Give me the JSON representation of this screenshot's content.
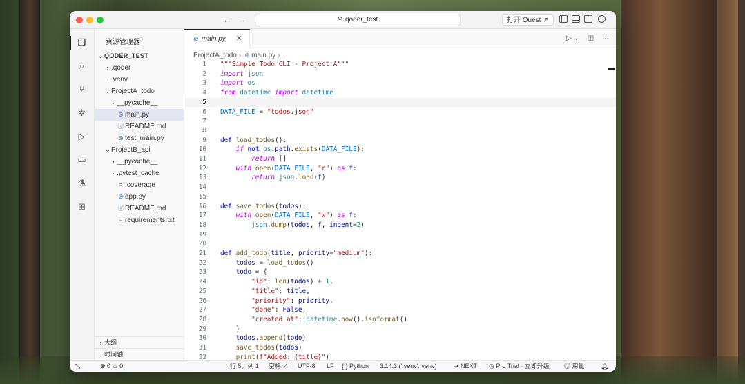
{
  "titlebar": {
    "search_text": "qoder_test",
    "quest_label": "打开 Quest ↗"
  },
  "sidebar": {
    "title": "资源管理器",
    "root": "QODER_TEST",
    "items": [
      {
        "label": ".qoder",
        "kind": "folder",
        "chev": "›"
      },
      {
        "label": ".venv",
        "kind": "folder",
        "chev": "›"
      },
      {
        "label": "ProjectA_todo",
        "kind": "folder-open",
        "chev": "⌄"
      },
      {
        "label": "__pycache__",
        "kind": "folder",
        "chev": "›"
      },
      {
        "label": "main.py",
        "kind": "py",
        "chev": ""
      },
      {
        "label": "README.md",
        "kind": "md",
        "chev": ""
      },
      {
        "label": "test_main.py",
        "kind": "py",
        "chev": ""
      },
      {
        "label": "ProjectB_api",
        "kind": "folder-open",
        "chev": "⌄"
      },
      {
        "label": "__pycache__",
        "kind": "folder",
        "chev": "›"
      },
      {
        "label": ".pytest_cache",
        "kind": "folder",
        "chev": "›"
      },
      {
        "label": ".coverage",
        "kind": "txt",
        "chev": ""
      },
      {
        "label": "app.py",
        "kind": "py",
        "chev": ""
      },
      {
        "label": "README.md",
        "kind": "md",
        "chev": ""
      },
      {
        "label": "requirements.txt",
        "kind": "txt",
        "chev": ""
      }
    ],
    "outline_label": "大纲",
    "timeline_label": "时间轴"
  },
  "editor": {
    "tab_label": "main.py",
    "breadcrumb": [
      "ProjectA_todo",
      "main.py",
      "..."
    ],
    "current_line": 5,
    "lines": [
      {
        "n": "1",
        "html": "<span class='docstr'>\"\"\"Simple Todo CLI - Project A\"\"\"</span>"
      },
      {
        "n": "2",
        "html": "<span class='kw-i'>import</span> <span class='mod'>json</span>"
      },
      {
        "n": "3",
        "html": "<span class='kw-i'>import</span> <span class='mod'>os</span>"
      },
      {
        "n": "4",
        "html": "<span class='kw-i'>from</span> <span class='mod'>datetime</span> <span class='kw-i'>import</span> <span class='mod'>datetime</span>"
      },
      {
        "n": "5",
        "html": ""
      },
      {
        "n": "6",
        "html": "<span class='const'>DATA_FILE</span> = <span class='str'>\"todos.json\"</span>"
      },
      {
        "n": "7",
        "html": ""
      },
      {
        "n": "8",
        "html": ""
      },
      {
        "n": "9",
        "html": "<span class='kw'>def</span> <span class='fn'>load_todos</span>():"
      },
      {
        "n": "10",
        "html": "    <span class='kw-i'>if</span> <span class='kw'>not</span> <span class='mod'>os</span>.<span class='var'>path</span>.<span class='fn'>exists</span>(<span class='const'>DATA_FILE</span>):"
      },
      {
        "n": "11",
        "html": "        <span class='kw-i'>return</span> []"
      },
      {
        "n": "12",
        "html": "    <span class='kw-i'>with</span> <span class='fn'>open</span>(<span class='const'>DATA_FILE</span>, <span class='str'>\"r\"</span>) <span class='kw-i'>as</span> <span class='var'>f</span>:"
      },
      {
        "n": "13",
        "html": "        <span class='kw-i'>return</span> <span class='mod'>json</span>.<span class='fn'>load</span>(<span class='var'>f</span>)"
      },
      {
        "n": "14",
        "html": ""
      },
      {
        "n": "15",
        "html": ""
      },
      {
        "n": "16",
        "html": "<span class='kw'>def</span> <span class='fn'>save_todos</span>(<span class='var'>todos</span>):"
      },
      {
        "n": "17",
        "html": "    <span class='kw-i'>with</span> <span class='fn'>open</span>(<span class='const'>DATA_FILE</span>, <span class='str'>\"w\"</span>) <span class='kw-i'>as</span> <span class='var'>f</span>:"
      },
      {
        "n": "18",
        "html": "        <span class='mod'>json</span>.<span class='fn'>dump</span>(<span class='var'>todos</span>, <span class='var'>f</span>, <span class='var'>indent</span>=<span class='num'>2</span>)"
      },
      {
        "n": "19",
        "html": ""
      },
      {
        "n": "20",
        "html": ""
      },
      {
        "n": "21",
        "html": "<span class='kw'>def</span> <span class='fn'>add_todo</span>(<span class='var'>title</span>, <span class='var'>priority</span>=<span class='str'>\"medium\"</span>):"
      },
      {
        "n": "22",
        "html": "    <span class='var'>todos</span> = <span class='fn'>load_todos</span>()"
      },
      {
        "n": "23",
        "html": "    <span class='var'>todo</span> = {"
      },
      {
        "n": "24",
        "html": "        <span class='str'>\"id\"</span>: <span class='fn'>len</span>(<span class='var'>todos</span>) + <span class='num'>1</span>,"
      },
      {
        "n": "25",
        "html": "        <span class='str'>\"title\"</span>: <span class='var'>title</span>,"
      },
      {
        "n": "26",
        "html": "        <span class='str'>\"priority\"</span>: <span class='var'>priority</span>,"
      },
      {
        "n": "27",
        "html": "        <span class='str'>\"done\"</span>: <span class='kw'>False</span>,"
      },
      {
        "n": "28",
        "html": "        <span class='str'>\"created_at\"</span>: <span class='mod'>datetime</span>.<span class='fn'>now</span>().<span class='fn'>isoformat</span>()"
      },
      {
        "n": "29",
        "html": "    }"
      },
      {
        "n": "30",
        "html": "    <span class='var'>todos</span>.<span class='fn'>append</span>(<span class='var'>todo</span>)"
      },
      {
        "n": "31",
        "html": "    <span class='fn'>save_todos</span>(<span class='var'>todos</span>)"
      },
      {
        "n": "32",
        "html": "    <span class='fn'>print</span>(<span class='str'>f\"Added: {title}\"</span>)"
      }
    ]
  },
  "status": {
    "problems": "⊗ 0 ⚠ 0",
    "position": "行 5，列 1",
    "spaces": "空格: 4",
    "encoding": "UTF-8",
    "eol": "LF",
    "language": "{ } Python",
    "interpreter": "3.14.3 ('.venv': venv)",
    "next": "⇥ NEXT",
    "trial": "Pro Trial · 立即升级",
    "usage": "用量"
  },
  "colors": {
    "accent": "#1f1f1f",
    "selected_row": "#e4e6f1",
    "keyword": "#0000ff",
    "string": "#a31515"
  }
}
